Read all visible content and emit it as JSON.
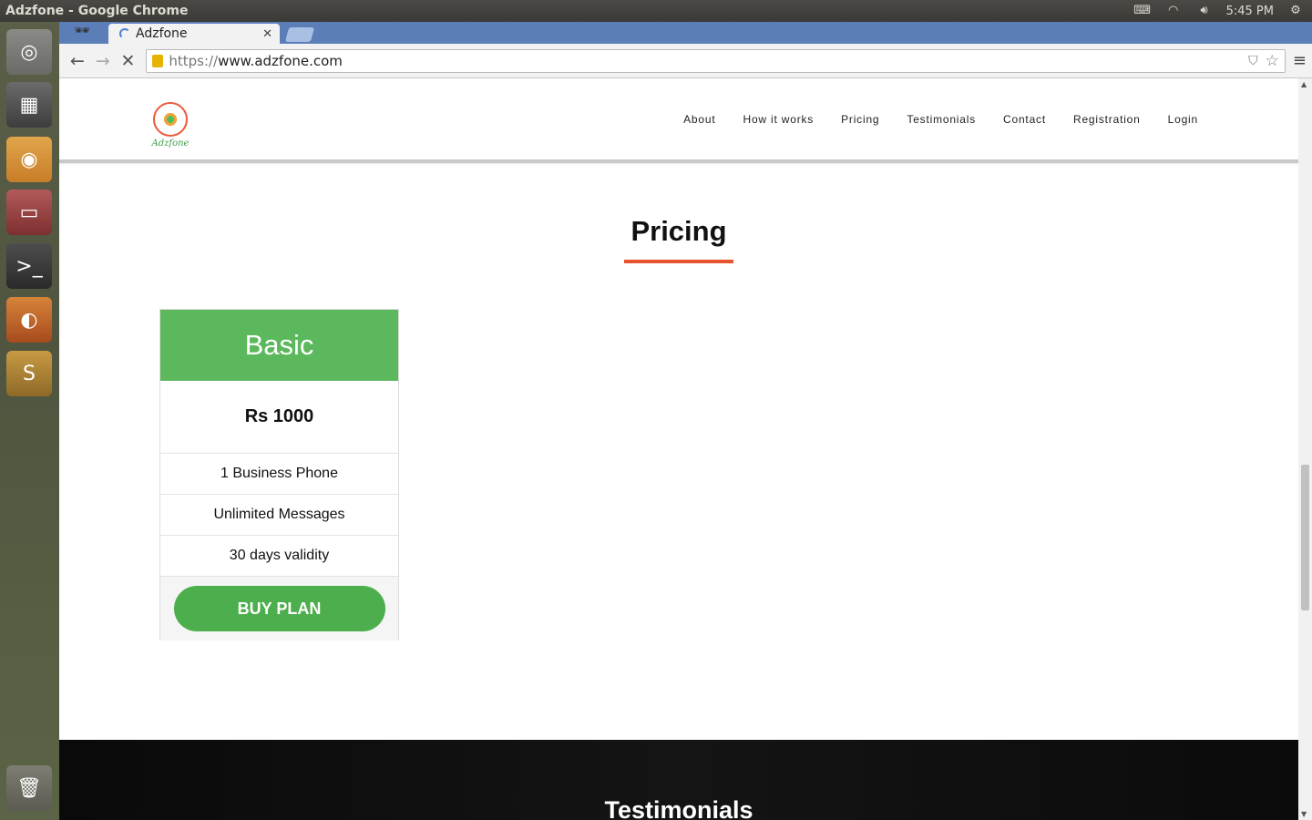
{
  "os": {
    "window_title": "Adzfone - Google Chrome",
    "clock": "5:45 PM"
  },
  "launcher": {
    "items": [
      "ubuntu-dash-icon",
      "calculator-icon",
      "chrome-icon",
      "files-icon",
      "terminal-icon",
      "firefox-icon",
      "sublime-text-icon",
      "trash-icon"
    ]
  },
  "browser": {
    "tab_title": "Adzfone",
    "url_scheme": "https://",
    "url_rest": "www.adzfone.com"
  },
  "site": {
    "logo_text": "Adzfone",
    "nav": [
      "About",
      "How it works",
      "Pricing",
      "Testimonials",
      "Contact",
      "Registration",
      "Login"
    ]
  },
  "pricing": {
    "title": "Pricing",
    "accent_color": "#e6532c",
    "plan": {
      "name": "Basic",
      "price": "Rs 1000",
      "features": [
        "1 Business Phone",
        "Unlimited Messages",
        "30 days validity"
      ],
      "button_label": "BUY PLAN",
      "color": "#5cb85c"
    }
  },
  "testimonials": {
    "title": "Testimonials"
  }
}
